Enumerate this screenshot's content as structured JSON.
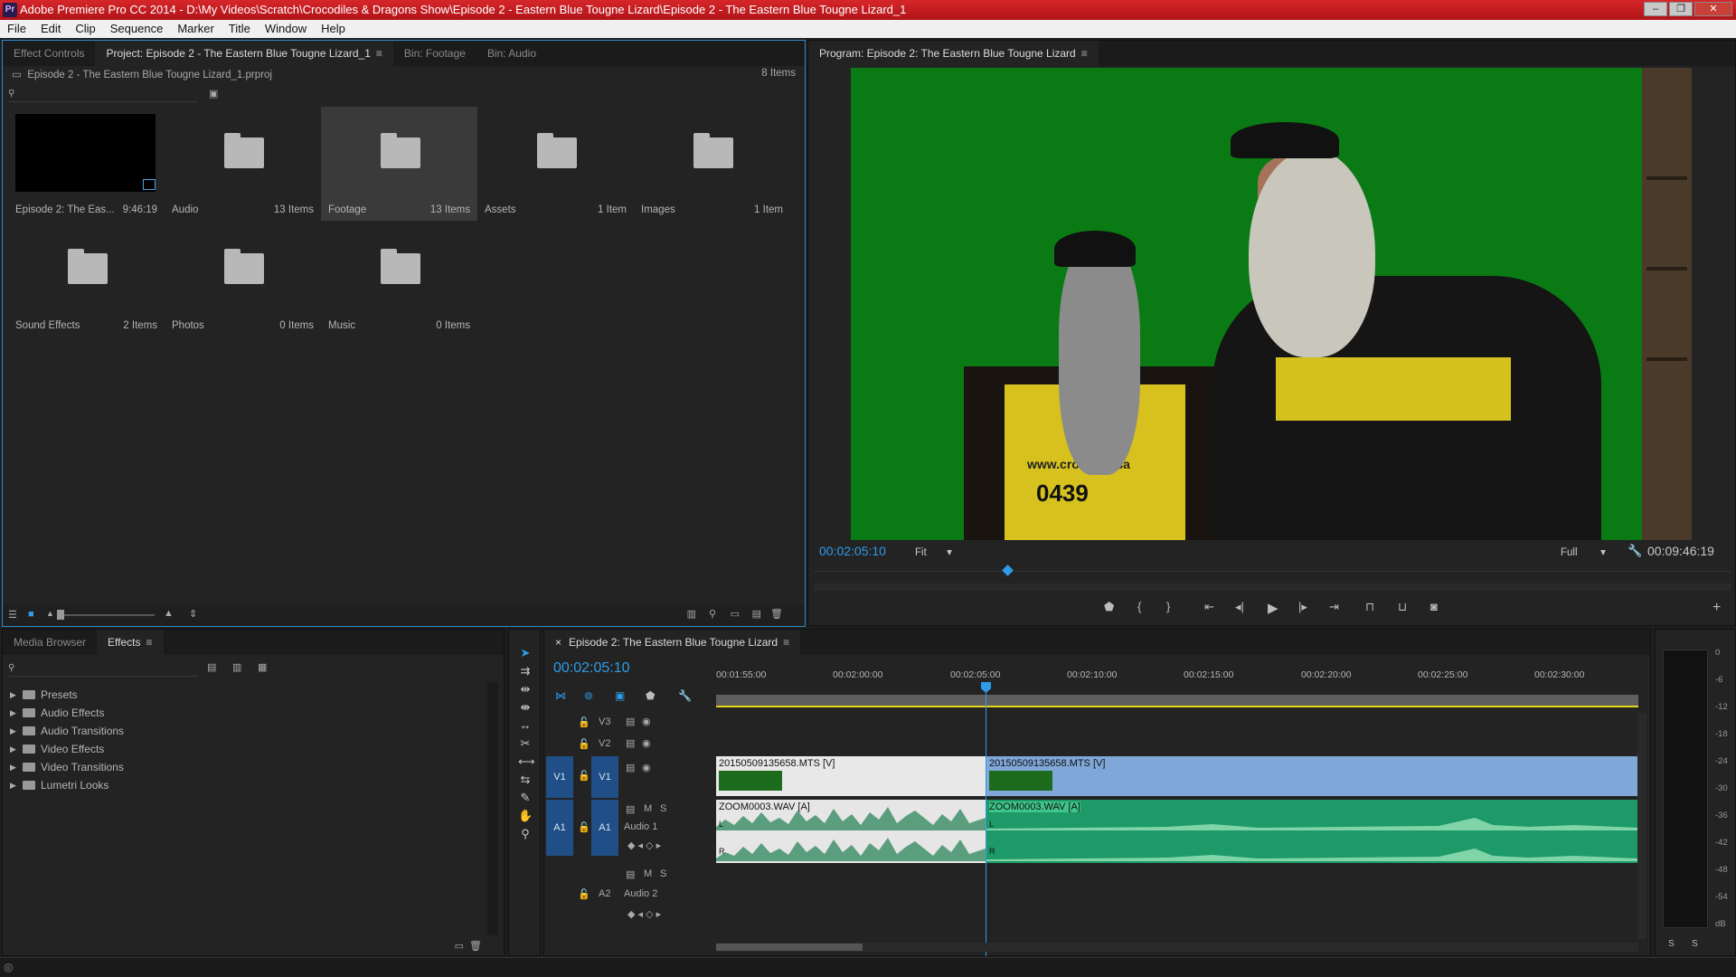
{
  "window": {
    "title": "Adobe Premiere Pro CC 2014 - D:\\My Videos\\Scratch\\Crocodiles & Dragons Show\\Episode 2 - Eastern Blue Tougne Lizard\\Episode 2 - The Eastern Blue Tougne Lizard_1",
    "app_icon": "Pr"
  },
  "menu": [
    "File",
    "Edit",
    "Clip",
    "Sequence",
    "Marker",
    "Title",
    "Window",
    "Help"
  ],
  "project_panel": {
    "tabs": [
      "Effect Controls",
      "Project: Episode 2 - The Eastern Blue Tougne Lizard_1",
      "Bin: Footage",
      "Bin: Audio"
    ],
    "file": "Episode 2 - The Eastern Blue Tougne Lizard_1.prproj",
    "item_count": "8 Items",
    "items": [
      {
        "name": "Episode 2: The Eas...",
        "count": "9:46:19",
        "type": "sequence"
      },
      {
        "name": "Audio",
        "count": "13 Items",
        "type": "folder"
      },
      {
        "name": "Footage",
        "count": "13 Items",
        "type": "folder",
        "selected": true
      },
      {
        "name": "Assets",
        "count": "1 Item",
        "type": "folder"
      },
      {
        "name": "Images",
        "count": "1 Item",
        "type": "folder"
      },
      {
        "name": "Sound Effects",
        "count": "2 Items",
        "type": "folder"
      },
      {
        "name": "Photos",
        "count": "0 Items",
        "type": "folder"
      },
      {
        "name": "Music",
        "count": "0 Items",
        "type": "folder"
      }
    ]
  },
  "program_monitor": {
    "tab": "Program: Episode 2: The Eastern Blue Tougne Lizard",
    "current_timecode": "00:02:05:10",
    "duration": "00:09:46:19",
    "zoom": "Fit",
    "resolution": "Full",
    "video_text": "0439",
    "video_site": "www.crocodilesa"
  },
  "effects_panel": {
    "tabs": [
      "Media Browser",
      "Effects"
    ],
    "items": [
      "Presets",
      "Audio Effects",
      "Audio Transitions",
      "Video Effects",
      "Video Transitions",
      "Lumetri Looks"
    ]
  },
  "timeline": {
    "tab": "Episode 2: The Eastern Blue Tougne Lizard",
    "timecode": "00:02:05:10",
    "ruler": [
      "00:01:55:00",
      "00:02:00:00",
      "00:02:05:00",
      "00:02:10:00",
      "00:02:15:00",
      "00:02:20:00",
      "00:02:25:00",
      "00:02:30:00"
    ],
    "tracks": {
      "v3": "V3",
      "v2": "V2",
      "v1": "V1",
      "a1": "A1",
      "a2": "A2",
      "audio1_name": "Audio 1",
      "audio2_name": "Audio 2",
      "m": "M",
      "s": "S"
    },
    "clips": {
      "v1_a": "20150509135658.MTS [V]",
      "v1_b": "20150509135658.MTS [V]",
      "a1_a": "ZOOM0003.WAV [A]",
      "a1_b": "ZOOM0003.WAV [A]"
    },
    "channel_labels": {
      "l": "L",
      "r": "R"
    }
  },
  "audio_meter": {
    "db_labels": [
      "0",
      "-6",
      "-12",
      "-18",
      "-24",
      "-30",
      "-36",
      "-42",
      "-48",
      "-54",
      "dB"
    ],
    "solo": [
      "S",
      "S"
    ]
  },
  "colors": {
    "accent": "#2f9be8",
    "title_bar": "#c21c20",
    "video_clip_selected": "#7fa7d8",
    "audio_clip": "#1e9a68",
    "work_area": "#e8d21a"
  }
}
